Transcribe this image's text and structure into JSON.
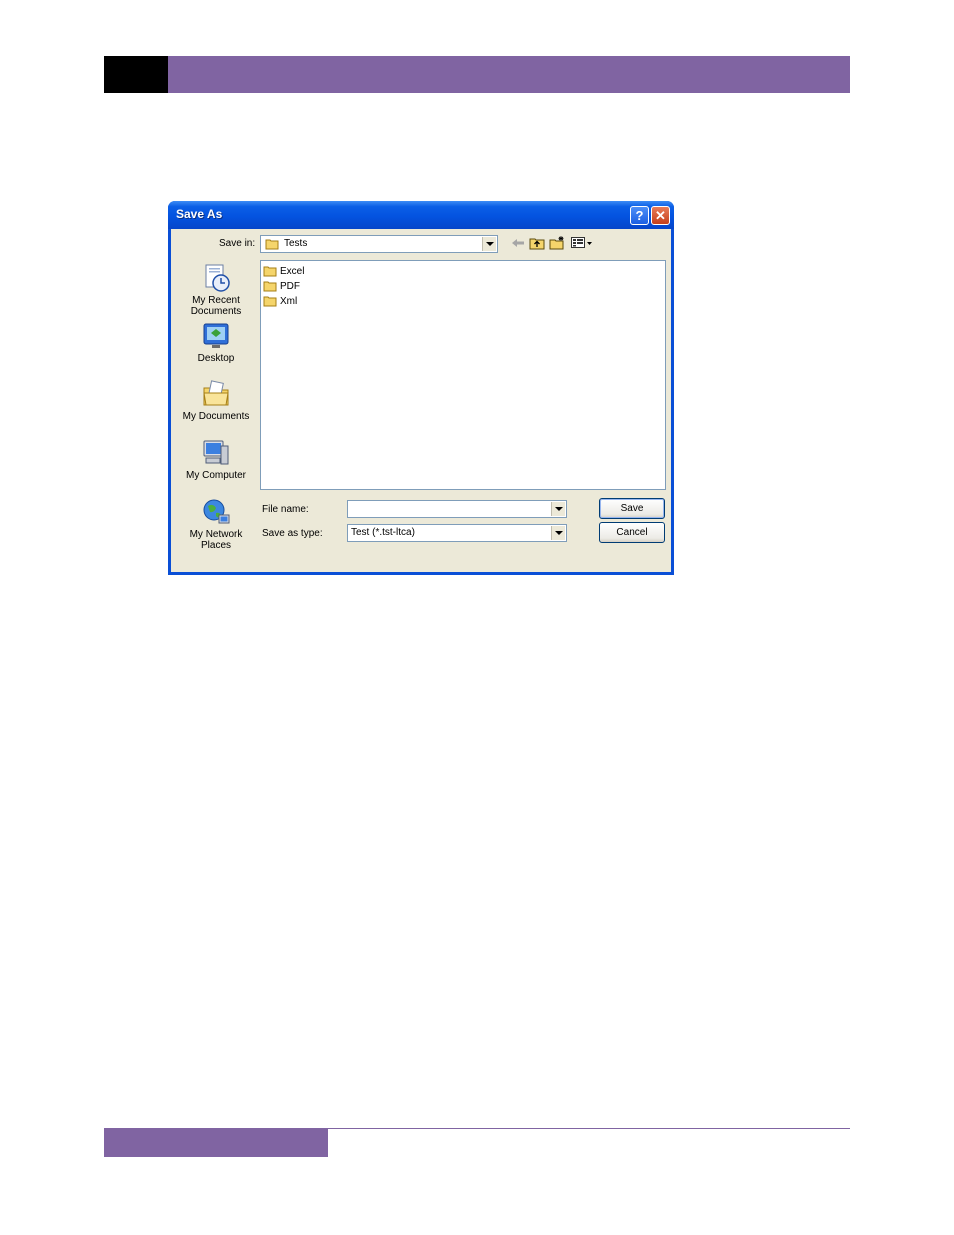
{
  "dialog": {
    "title": "Save As",
    "help_icon": "question-mark-icon",
    "close_icon": "close-x-icon"
  },
  "save_in": {
    "label": "Save in:",
    "value": "Tests"
  },
  "places": [
    {
      "label_line1": "My Recent",
      "label_line2": "Documents",
      "icon": "recent-documents-icon"
    },
    {
      "label_line1": "Desktop",
      "label_line2": "",
      "icon": "desktop-icon"
    },
    {
      "label_line1": "My Documents",
      "label_line2": "",
      "icon": "my-documents-icon"
    },
    {
      "label_line1": "My Computer",
      "label_line2": "",
      "icon": "my-computer-icon"
    },
    {
      "label_line1": "My Network",
      "label_line2": "Places",
      "icon": "network-places-icon"
    }
  ],
  "files": [
    {
      "name": "Excel",
      "icon": "folder-icon"
    },
    {
      "name": "PDF",
      "icon": "folder-icon"
    },
    {
      "name": "Xml",
      "icon": "folder-icon"
    }
  ],
  "file_name": {
    "label": "File name:",
    "value": ""
  },
  "save_as_type": {
    "label": "Save as type:",
    "value": "Test (*.tst-ltca)"
  },
  "buttons": {
    "save": "Save",
    "cancel": "Cancel"
  },
  "colors": {
    "accent_purple": "#8064a2",
    "title_blue": "#0453e0",
    "dialog_face": "#ece9d8"
  }
}
